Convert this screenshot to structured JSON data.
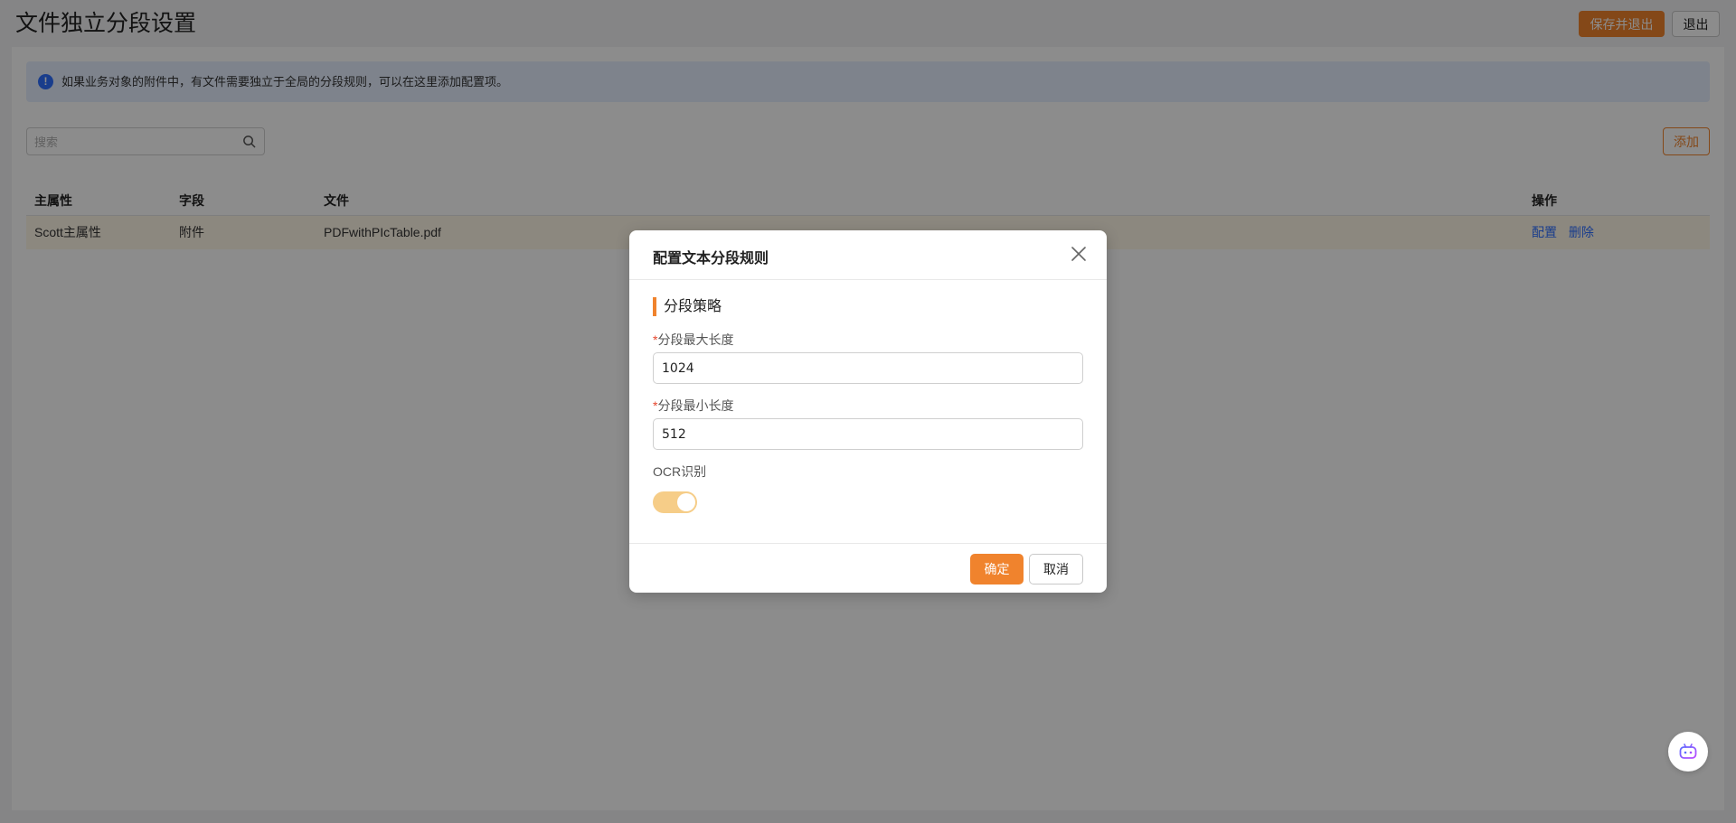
{
  "header": {
    "title": "文件独立分段设置",
    "save_exit_label": "保存并退出",
    "exit_label": "退出"
  },
  "alert": {
    "icon": "exclamation-icon",
    "text": "如果业务对象的附件中，有文件需要独立于全局的分段规则，可以在这里添加配置项。"
  },
  "search": {
    "placeholder": "搜索",
    "value": ""
  },
  "toolbar": {
    "add_label": "添加"
  },
  "table": {
    "columns": [
      "主属性",
      "字段",
      "文件",
      "操作"
    ],
    "rows": [
      {
        "main_attr": "Scott主属性",
        "field": "附件",
        "file": "PDFwithPIcTable.pdf",
        "actions": [
          "配置",
          "删除"
        ]
      }
    ]
  },
  "dialog": {
    "title": "配置文本分段规则",
    "section_title": "分段策略",
    "required_mark": "*",
    "max_length_label": "分段最大长度",
    "max_length_value": "1024",
    "min_length_label": "分段最小长度",
    "min_length_value": "512",
    "ocr_label": "OCR识别",
    "ocr_enabled": true,
    "ok_label": "确定",
    "cancel_label": "取消"
  },
  "colors": {
    "accent": "#f0832d",
    "link": "#2f6fff",
    "toggle_on": "#f6cd88",
    "alert_bg": "#e6efff",
    "row_highlight": "#fff7e8"
  }
}
